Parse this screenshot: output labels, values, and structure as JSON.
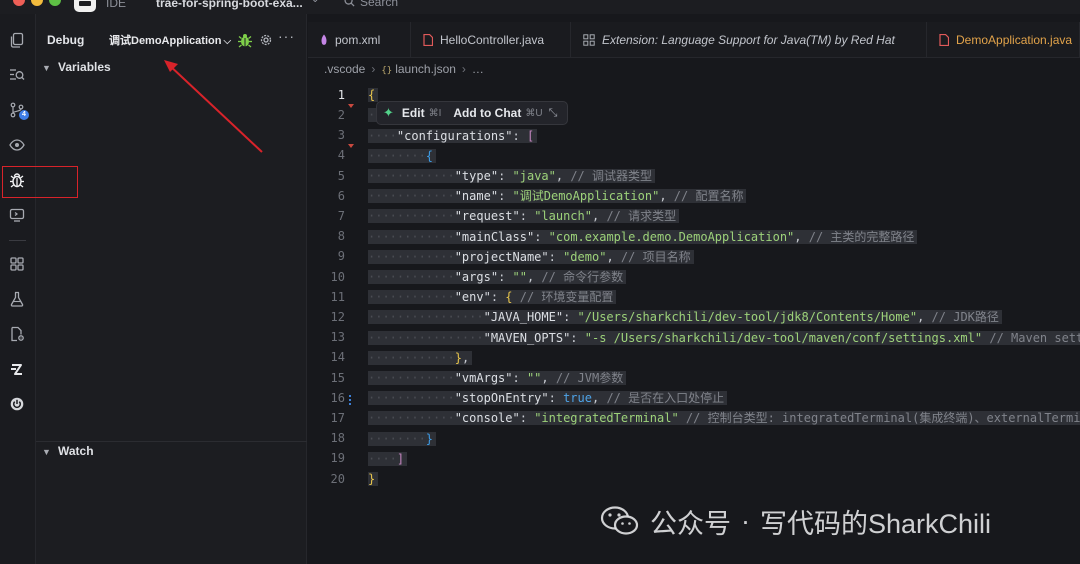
{
  "titlebar": {
    "ide_label": "IDE",
    "project_name": "trae-for-spring-boot-exa...",
    "search_placeholder": "Search"
  },
  "activity_bar": {
    "items": [
      "explorer",
      "search",
      "source-control",
      "preview",
      "run-and-debug",
      "remote",
      "extensions",
      "testing",
      "settings",
      "trae",
      "power"
    ],
    "source_control_badge": "4",
    "highlighted": "run-and-debug"
  },
  "sidebar": {
    "title": "Debug",
    "config_name": "调试DemoApplication",
    "variables_label": "Variables",
    "watch_label": "Watch"
  },
  "tabs": [
    {
      "label": "pom.xml",
      "icon": "maven-icon",
      "italic": false,
      "active": false
    },
    {
      "label": "HelloController.java",
      "icon": "java-file-icon",
      "italic": false,
      "active": false
    },
    {
      "label": "Extension: Language Support for Java(TM) by Red Hat",
      "icon": "extension-icon",
      "italic": true,
      "active": false
    },
    {
      "label": "DemoApplication.java",
      "icon": "java-file-icon",
      "italic": false,
      "active": true
    }
  ],
  "breadcrumb": {
    "folder": ".vscode",
    "file": "launch.json",
    "more": "…"
  },
  "inline_toolbar": {
    "edit_label": "Edit",
    "edit_shortcut": "⌘I",
    "chat_label": "Add to Chat",
    "chat_shortcut": "⌘U"
  },
  "editor": {
    "line_numbers": [
      "1",
      "2",
      "3",
      "4",
      "5",
      "6",
      "7",
      "8",
      "9",
      "10",
      "11",
      "12",
      "13",
      "14",
      "15",
      "16",
      "17",
      "18",
      "19",
      "20"
    ],
    "current_line": "1",
    "code": {
      "l5": {
        "key": "\"type\"",
        "val": "\"java\"",
        "comment": "// 调试器类型"
      },
      "l6": {
        "key": "\"name\"",
        "val": "\"调试DemoApplication\"",
        "comment": "// 配置名称"
      },
      "l7": {
        "key": "\"request\"",
        "val": "\"launch\"",
        "comment": "// 请求类型"
      },
      "l8": {
        "key": "\"mainClass\"",
        "val": "\"com.example.demo.DemoApplication\"",
        "comment": "// 主类的完整路径"
      },
      "l9": {
        "key": "\"projectName\"",
        "val": "\"demo\"",
        "comment": "// 项目名称"
      },
      "l10": {
        "key": "\"args\"",
        "val": "\"\"",
        "comment": "// 命令行参数"
      },
      "l11": {
        "key": "\"env\"",
        "comment": "// 环境变量配置"
      },
      "l12": {
        "key": "\"JAVA_HOME\"",
        "val": "\"/Users/sharkchili/dev-tool/jdk8/Contents/Home\"",
        "comment": "// JDK路径"
      },
      "l13": {
        "key": "\"MAVEN_OPTS\"",
        "val": "\"-s /Users/sharkchili/dev-tool/maven/conf/settings.xml\"",
        "comment": "// Maven setti"
      },
      "l15": {
        "key": "\"vmArgs\"",
        "val": "\"\"",
        "comment": "// JVM参数"
      },
      "l16": {
        "key": "\"stopOnEntry\"",
        "val": "true",
        "comment": "// 是否在入口处停止"
      },
      "l17": {
        "key": "\"console\"",
        "val": "\"integratedTerminal\"",
        "comment": "// 控制台类型: integratedTerminal(集成终端)、externalTermin"
      },
      "l3": {
        "key": "\"configurations\""
      }
    }
  },
  "watermark": {
    "brand": "公众号",
    "separator": "·",
    "author": "写代码的SharkChili"
  },
  "colors": {
    "accent_red": "#d8232a",
    "string_green": "#9dd27a",
    "active_tab_orange": "#e2a34a",
    "badge_blue": "#3f7ee8"
  }
}
